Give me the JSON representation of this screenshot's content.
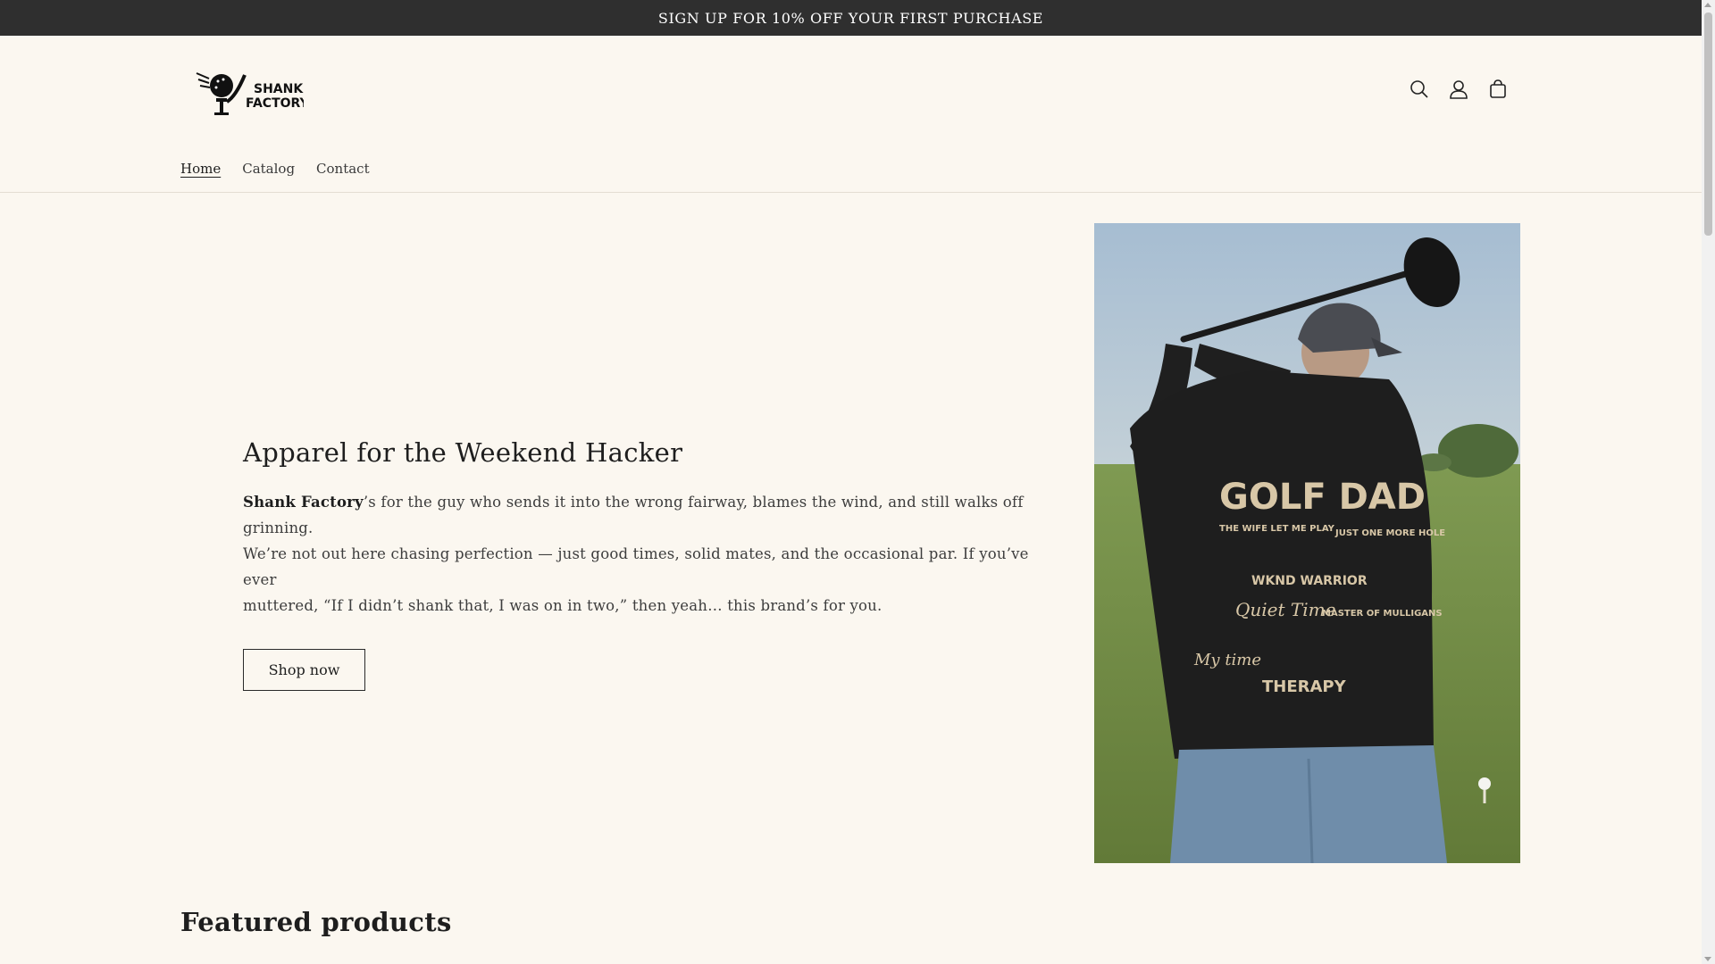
{
  "announcement": {
    "text": "SIGN UP FOR 10% OFF YOUR FIRST PURCHASE"
  },
  "header": {
    "logo_text": [
      "SHANK",
      "FACTORY"
    ],
    "icons": [
      "search-icon",
      "account-icon",
      "cart-icon"
    ]
  },
  "nav": {
    "items": [
      {
        "label": "Home",
        "active": true
      },
      {
        "label": "Catalog",
        "active": false
      },
      {
        "label": "Contact",
        "active": false
      }
    ]
  },
  "hero": {
    "heading": "Apparel for the Weekend Hacker",
    "brand": "Shank Factory",
    "body_line_1": "’s for the guy who sends it into the wrong fairway, blames the wind, and still walks off grinning.",
    "body_line_2": "We’re not out here chasing perfection — just good times, solid mates, and the occasional par. If you’ve ever",
    "body_line_3": "muttered, “If I didn’t shank that, I was on in two,” then yeah… this brand’s for you.",
    "button_label": "Shop now"
  },
  "hero_image": {
    "print_title": "GOLF DAD",
    "print_phrases": [
      "THE WIFE LET ME PLAY",
      "JUST ONE MORE HOLE",
      "WKND WARRIOR",
      "Quiet Time",
      "MASTER OF MULLIGANS",
      "My time",
      "THERAPY"
    ]
  },
  "featured": {
    "heading": "Featured products"
  },
  "colors": {
    "announcement_bg": "#2f2f2f",
    "page_bg": "#fbf7f0",
    "text": "#1e1e1e"
  }
}
